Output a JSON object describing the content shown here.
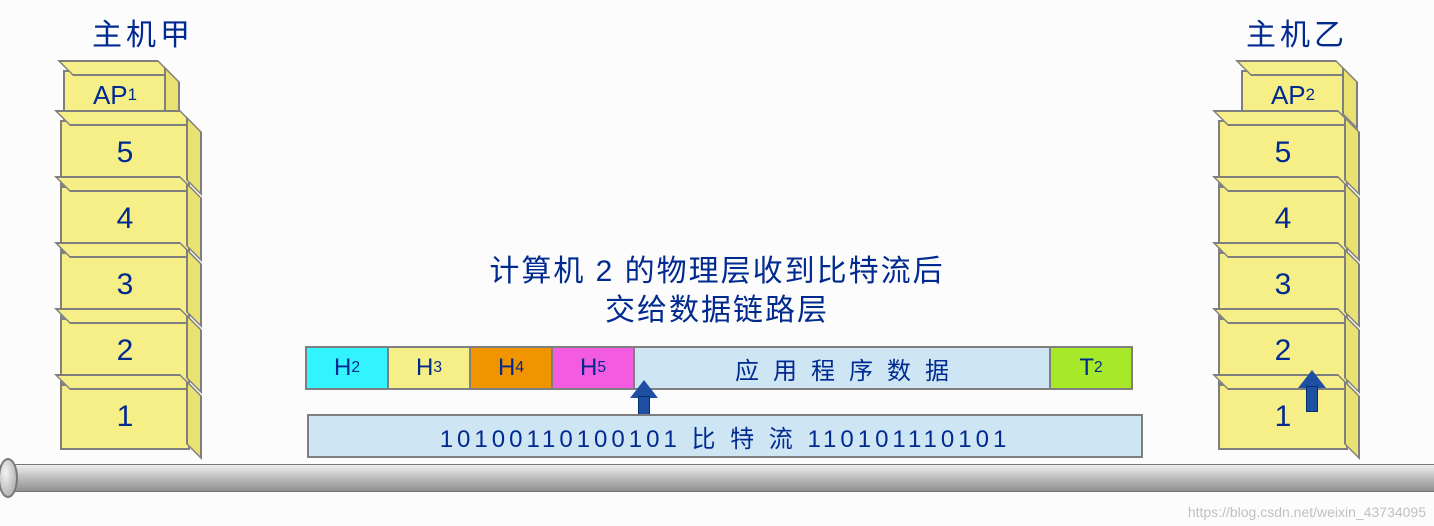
{
  "hosts": {
    "left": {
      "title": "主机甲",
      "ap": "AP",
      "ap_sub": "1"
    },
    "right": {
      "title": "主机乙",
      "ap": "AP",
      "ap_sub": "2"
    }
  },
  "layers": [
    "5",
    "4",
    "3",
    "2",
    "1"
  ],
  "caption": {
    "line1": "计算机 2 的物理层收到比特流后",
    "line2": "交给数据链路层"
  },
  "frame": {
    "H2": "H",
    "H2_sub": "2",
    "H3": "H",
    "H3_sub": "3",
    "H4": "H",
    "H4_sub": "4",
    "H5": "H",
    "H5_sub": "5",
    "data": "应用程序数据",
    "T2": "T",
    "T2_sub": "2"
  },
  "bitstream": "10100110100101  比 特 流 110101110101",
  "watermark": "https://blog.csdn.net/weixin_43734095"
}
